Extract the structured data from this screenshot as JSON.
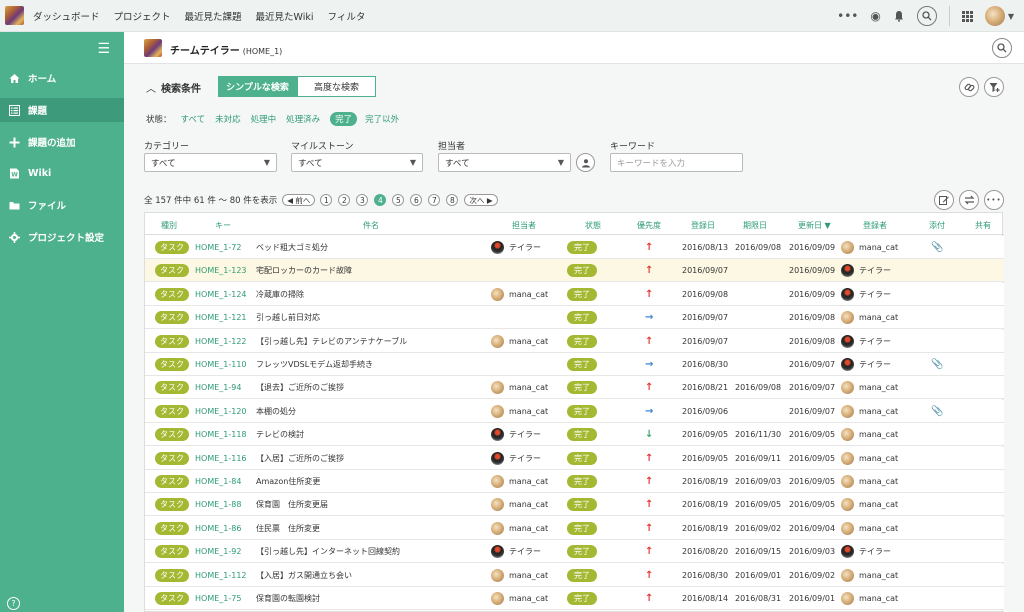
{
  "topbar": {
    "nav": [
      "ダッシュボード",
      "プロジェクト",
      "最近見た課題",
      "最近見たWiki",
      "フィルタ"
    ],
    "icons": [
      "more-dots-icon",
      "eye-icon",
      "bell-icon",
      "search-icon",
      "grid-apps-icon",
      "user-avatar",
      "caret-down-icon"
    ]
  },
  "sidebar": {
    "items": [
      {
        "label": "ホーム",
        "icon": "home-icon"
      },
      {
        "label": "課題",
        "icon": "list-icon"
      },
      {
        "label": "課題の追加",
        "icon": "plus-icon"
      },
      {
        "label": "Wiki",
        "icon": "wiki-icon"
      },
      {
        "label": "ファイル",
        "icon": "folder-icon"
      },
      {
        "label": "プロジェクト設定",
        "icon": "gear-icon"
      }
    ],
    "help": "?"
  },
  "project": {
    "name": "チームテイラー",
    "key": "(HOME_1)"
  },
  "search": {
    "title": "検索条件",
    "simple_label": "シンプルな検索",
    "advanced_label": "高度な検索",
    "status_label": "状態：",
    "status_options": [
      "すべて",
      "未対応",
      "処理中",
      "処理済み",
      "完了",
      "完了以外"
    ],
    "status_selected": "完了",
    "category_label": "カテゴリー",
    "category_value": "すべて",
    "milestone_label": "マイルストーン",
    "milestone_value": "すべて",
    "assignee_label": "担当者",
    "assignee_value": "すべて",
    "keyword_label": "キーワード",
    "keyword_placeholder": "キーワードを入力"
  },
  "pager": {
    "summary": "全 157 件中 61 件 ～ 80 件を表示",
    "prev": "◀ 前へ",
    "next": "次へ ▶",
    "pages": [
      "1",
      "2",
      "3",
      "4",
      "5",
      "6",
      "7",
      "8"
    ],
    "current": "4"
  },
  "table": {
    "headers": [
      "種別",
      "キー",
      "件名",
      "担当者",
      "状態",
      "優先度",
      "登録日",
      "期限日",
      "更新日 ▼",
      "登録者",
      "添付",
      "共有"
    ],
    "rows": [
      {
        "type": "タスク",
        "key": "HOME_1-72",
        "subject": "ベッド粗大ゴミ処分",
        "assignee": "テイラー",
        "assignee_avatar": "taylor",
        "status": "完了",
        "priority": "high",
        "created": "2016/08/13",
        "due": "2016/09/08",
        "updated": "2016/09/09",
        "reporter": "mana_cat",
        "reporter_avatar": "cat",
        "attach": true
      },
      {
        "type": "タスク",
        "key": "HOME_1-123",
        "subject": "宅配ロッカーのカード故障",
        "assignee": "",
        "assignee_avatar": "",
        "status": "完了",
        "priority": "high",
        "created": "2016/09/07",
        "due": "",
        "updated": "2016/09/09",
        "reporter": "テイラー",
        "reporter_avatar": "taylor",
        "attach": false
      },
      {
        "type": "タスク",
        "key": "HOME_1-124",
        "subject": "冷蔵庫の掃除",
        "assignee": "mana_cat",
        "assignee_avatar": "cat",
        "status": "完了",
        "priority": "high",
        "created": "2016/09/08",
        "due": "",
        "updated": "2016/09/09",
        "reporter": "テイラー",
        "reporter_avatar": "taylor",
        "attach": false
      },
      {
        "type": "タスク",
        "key": "HOME_1-121",
        "subject": "引っ越し前日対応",
        "assignee": "",
        "assignee_avatar": "",
        "status": "完了",
        "priority": "mid",
        "created": "2016/09/07",
        "due": "",
        "updated": "2016/09/08",
        "reporter": "mana_cat",
        "reporter_avatar": "cat",
        "attach": false
      },
      {
        "type": "タスク",
        "key": "HOME_1-122",
        "subject": "【引っ越し先】テレビのアンテナケーブル",
        "assignee": "mana_cat",
        "assignee_avatar": "cat",
        "status": "完了",
        "priority": "high",
        "created": "2016/09/07",
        "due": "",
        "updated": "2016/09/08",
        "reporter": "テイラー",
        "reporter_avatar": "taylor",
        "attach": false
      },
      {
        "type": "タスク",
        "key": "HOME_1-110",
        "subject": "フレッツVDSLモデム返却手続き",
        "assignee": "",
        "assignee_avatar": "",
        "status": "完了",
        "priority": "mid",
        "created": "2016/08/30",
        "due": "",
        "updated": "2016/09/07",
        "reporter": "テイラー",
        "reporter_avatar": "taylor",
        "attach": true
      },
      {
        "type": "タスク",
        "key": "HOME_1-94",
        "subject": "【退去】ご近所のご挨拶",
        "assignee": "mana_cat",
        "assignee_avatar": "cat",
        "status": "完了",
        "priority": "high",
        "created": "2016/08/21",
        "due": "2016/09/08",
        "updated": "2016/09/07",
        "reporter": "mana_cat",
        "reporter_avatar": "cat",
        "attach": false
      },
      {
        "type": "タスク",
        "key": "HOME_1-120",
        "subject": "本棚の処分",
        "assignee": "mana_cat",
        "assignee_avatar": "cat",
        "status": "完了",
        "priority": "mid",
        "created": "2016/09/06",
        "due": "",
        "updated": "2016/09/07",
        "reporter": "mana_cat",
        "reporter_avatar": "cat",
        "attach": true
      },
      {
        "type": "タスク",
        "key": "HOME_1-118",
        "subject": "テレビの検討",
        "assignee": "テイラー",
        "assignee_avatar": "taylor",
        "status": "完了",
        "priority": "low",
        "created": "2016/09/05",
        "due": "2016/11/30",
        "updated": "2016/09/05",
        "reporter": "mana_cat",
        "reporter_avatar": "cat",
        "attach": false
      },
      {
        "type": "タスク",
        "key": "HOME_1-116",
        "subject": "【入居】ご近所のご挨拶",
        "assignee": "テイラー",
        "assignee_avatar": "taylor",
        "status": "完了",
        "priority": "high",
        "created": "2016/09/05",
        "due": "2016/09/11",
        "updated": "2016/09/05",
        "reporter": "mana_cat",
        "reporter_avatar": "cat",
        "attach": false
      },
      {
        "type": "タスク",
        "key": "HOME_1-84",
        "subject": "Amazon住所変更",
        "assignee": "mana_cat",
        "assignee_avatar": "cat",
        "status": "完了",
        "priority": "high",
        "created": "2016/08/19",
        "due": "2016/09/03",
        "updated": "2016/09/05",
        "reporter": "mana_cat",
        "reporter_avatar": "cat",
        "attach": false
      },
      {
        "type": "タスク",
        "key": "HOME_1-88",
        "subject": "保育園　住所変更届",
        "assignee": "mana_cat",
        "assignee_avatar": "cat",
        "status": "完了",
        "priority": "high",
        "created": "2016/08/19",
        "due": "2016/09/05",
        "updated": "2016/09/05",
        "reporter": "mana_cat",
        "reporter_avatar": "cat",
        "attach": false
      },
      {
        "type": "タスク",
        "key": "HOME_1-86",
        "subject": "住民票　住所変更",
        "assignee": "mana_cat",
        "assignee_avatar": "cat",
        "status": "完了",
        "priority": "high",
        "created": "2016/08/19",
        "due": "2016/09/02",
        "updated": "2016/09/04",
        "reporter": "mana_cat",
        "reporter_avatar": "cat",
        "attach": false
      },
      {
        "type": "タスク",
        "key": "HOME_1-92",
        "subject": "【引っ越し先】インターネット回線契約",
        "assignee": "テイラー",
        "assignee_avatar": "taylor",
        "status": "完了",
        "priority": "high",
        "created": "2016/08/20",
        "due": "2016/09/15",
        "updated": "2016/09/03",
        "reporter": "テイラー",
        "reporter_avatar": "taylor",
        "attach": false
      },
      {
        "type": "タスク",
        "key": "HOME_1-112",
        "subject": "【入居】ガス開通立ち会い",
        "assignee": "mana_cat",
        "assignee_avatar": "cat",
        "status": "完了",
        "priority": "high",
        "created": "2016/08/30",
        "due": "2016/09/01",
        "updated": "2016/09/02",
        "reporter": "mana_cat",
        "reporter_avatar": "cat",
        "attach": false
      },
      {
        "type": "タスク",
        "key": "HOME_1-75",
        "subject": "保育園の転園検討",
        "assignee": "mana_cat",
        "assignee_avatar": "cat",
        "status": "完了",
        "priority": "high",
        "created": "2016/08/14",
        "due": "2016/08/31",
        "updated": "2016/09/01",
        "reporter": "mana_cat",
        "reporter_avatar": "cat",
        "attach": false
      }
    ]
  }
}
